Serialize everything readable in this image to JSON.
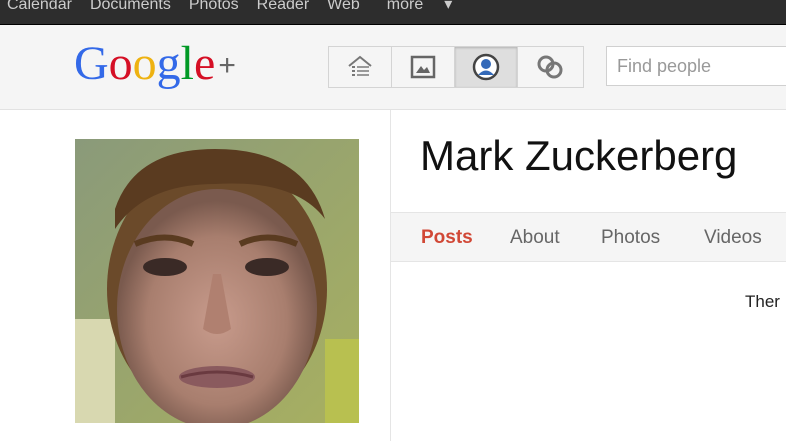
{
  "topbar": {
    "links": [
      "Calendar",
      "Documents",
      "Photos",
      "Reader",
      "Web"
    ],
    "more_label": "more",
    "more_caret": "▾"
  },
  "logo": {
    "letters": [
      "G",
      "o",
      "o",
      "g",
      "l",
      "e"
    ],
    "letter_colors": [
      "#3369e8",
      "#d50f25",
      "#eeb211",
      "#3369e8",
      "#009925",
      "#d50f25"
    ],
    "plus": "+"
  },
  "toolbar": {
    "buttons": [
      {
        "icon": "home-icon",
        "active": false
      },
      {
        "icon": "photos-icon",
        "active": false
      },
      {
        "icon": "profile-icon",
        "active": true
      },
      {
        "icon": "circles-icon",
        "active": false
      }
    ]
  },
  "search": {
    "placeholder": "Find people",
    "value": ""
  },
  "profile": {
    "name": "Mark Zuckerberg",
    "tabs": [
      {
        "label": "Posts",
        "active": true
      },
      {
        "label": "About",
        "active": false
      },
      {
        "label": "Photos",
        "active": false
      },
      {
        "label": "Videos",
        "active": false
      }
    ],
    "post_text": "Ther"
  },
  "colors": {
    "topbar": "#2d2d2d",
    "active_tab": "#d14836",
    "header_bg": "#f5f5f5"
  }
}
